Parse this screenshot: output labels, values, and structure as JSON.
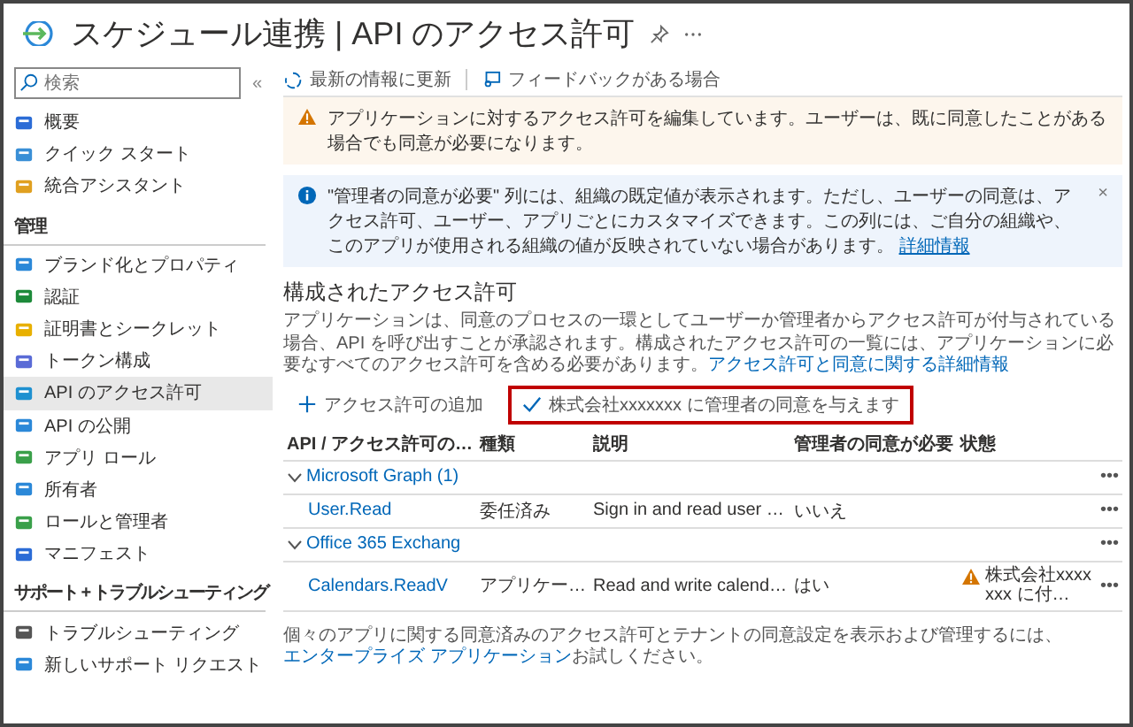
{
  "window": {
    "title": "スケジュール連携 | API のアクセス許可"
  },
  "sidebar": {
    "search": {
      "placeholder": "検索"
    },
    "collapse": "«",
    "sections": [
      {
        "items": [
          {
            "label": "概要",
            "selected": false
          },
          {
            "label": "クイック スタート",
            "selected": false
          },
          {
            "label": "統合アシスタント",
            "selected": false
          }
        ]
      },
      {
        "heading": "管理",
        "items": [
          {
            "label": "ブランド化とプロパティ",
            "selected": false
          },
          {
            "label": "認証",
            "selected": false
          },
          {
            "label": "証明書とシークレット",
            "selected": false
          },
          {
            "label": "トークン構成",
            "selected": false
          },
          {
            "label": "API のアクセス許可",
            "selected": true
          },
          {
            "label": "API の公開",
            "selected": false
          },
          {
            "label": "アプリ ロール",
            "selected": false
          },
          {
            "label": "所有者",
            "selected": false
          },
          {
            "label": "ロールと管理者",
            "selected": false
          },
          {
            "label": "マニフェスト",
            "selected": false
          }
        ]
      },
      {
        "heading": "サポート + トラブルシューティング",
        "items": [
          {
            "label": "トラブルシューティング",
            "selected": false
          },
          {
            "label": "新しいサポート リクエスト",
            "selected": false
          }
        ]
      }
    ]
  },
  "toolbar": [
    "最新の情報に更新",
    "フィードバックがある場合"
  ],
  "warning_banner": "アプリケーションに対するアクセス許可を編集しています。ユーザーは、既に同意したことがある場合でも同意が必要になります。",
  "info_banner": {
    "text": "\"管理者の同意が必要\" 列には、組織の既定値が表示されます。ただし、ユーザーの同意は、アクセス許可、ユーザー、アプリごとにカスタマイズできます。この列には、ご自分の組織や、このアプリが使用される組織の値が反映されていない場合があります。",
    "link": "詳細情報",
    "close": "×"
  },
  "section": {
    "heading": "構成されたアクセス許可",
    "description": "アプリケーションは、同意のプロセスの一環としてユーザーか管理者からアクセス許可が付与されている場合、API を呼び出すことが承認されます。構成されたアクセス許可の一覧には、アプリケーションに必要なすべてのアクセス許可を含める必要があります。",
    "link": "アクセス許可と同意に関する詳細情報"
  },
  "commands": [
    {
      "label": "アクセス許可の追加",
      "kind": "add",
      "highlighted": false
    },
    {
      "label": "株式会社xxxxxxx に管理者の同意を与えます",
      "kind": "grant",
      "highlighted": true
    }
  ],
  "table": {
    "columns": [
      "API / アクセス許可の…",
      "種類",
      "説明",
      "管理者の同意が必要",
      "状態"
    ],
    "groups": [
      {
        "name": "Microsoft Graph (1)",
        "expanded": true,
        "more": "•••",
        "rows": [
          {
            "name": "User.Read",
            "type": "委任済み",
            "description": "Sign in and read user …",
            "admin_consent": "いいえ",
            "more": "•••"
          }
        ]
      },
      {
        "name": "Office 365 Exchang",
        "expanded": true,
        "more": "•••",
        "rows": [
          {
            "name": "Calendars.ReadV",
            "type": "アプリケー…",
            "description": "Read and write calend…",
            "admin_consent": "はい",
            "status": {
              "text": "株式会社xxxxxxx に付…",
              "warning": true
            },
            "more": "•••"
          }
        ]
      }
    ]
  },
  "footer": {
    "text": "個々のアプリに関する同意済みのアクセス許可とテナントの同意設定を表示および管理するには、",
    "link": "エンタープライズ アプリケーション",
    "after": "お試しください。"
  }
}
